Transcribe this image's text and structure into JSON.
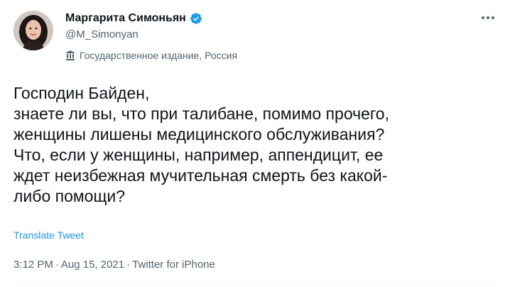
{
  "author": {
    "display_name": "Маргарита Симоньян",
    "handle": "@M_Simonyan",
    "verified": true,
    "label": "Государственное издание, Россия",
    "label_icon": "government-building-icon",
    "avatar": "profile-photo"
  },
  "tweet": {
    "text_lines": [
      "Господин Байден,",
      "знаете ли вы, что при талибане, помимо прочего,",
      "женщины лишены медицинского обслуживания?",
      "Что, если у женщины, например, аппендицит, ее",
      "ждет неизбежная мучительная смерть без какой-",
      "либо помощи?"
    ],
    "translate_label": "Translate Tweet",
    "time": "3:12 PM",
    "date": "Aug 15, 2021",
    "source": "Twitter for iPhone",
    "separator": "·"
  },
  "colors": {
    "text": "#0f1419",
    "secondary": "#536471",
    "accent": "#1d9bf0",
    "divider": "#eff3f4"
  }
}
